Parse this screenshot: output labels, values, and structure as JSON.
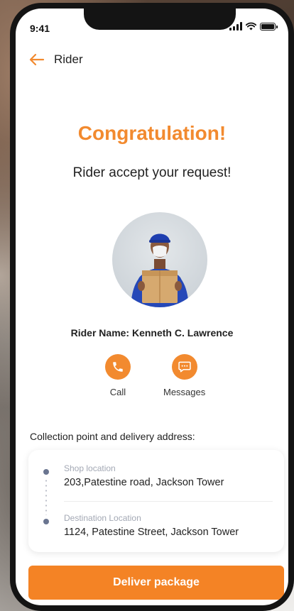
{
  "status_bar": {
    "time": "9:41"
  },
  "header": {
    "title": "Rider",
    "back_icon": "arrow-left-icon"
  },
  "confirmation": {
    "title": "Congratulation!",
    "subtitle": "Rider accept your request!"
  },
  "rider": {
    "name_line": "Rider Name: Kenneth C. Lawrence",
    "avatar_icon": "rider-photo"
  },
  "actions": [
    {
      "label": "Call",
      "icon": "phone-icon"
    },
    {
      "label": "Messages",
      "icon": "chat-icon"
    }
  ],
  "addresses": {
    "heading": "Collection point and delivery address:",
    "pickup": {
      "label": "Shop location",
      "value": "203,Patestine road, Jackson Tower"
    },
    "destination": {
      "label": "Destination Location",
      "value": "1124, Patestine Street, Jackson Tower"
    }
  },
  "cta": {
    "label": "Deliver package"
  },
  "colors": {
    "accent": "#f28a2f",
    "button": "#f48325",
    "dot": "#6a7590"
  }
}
